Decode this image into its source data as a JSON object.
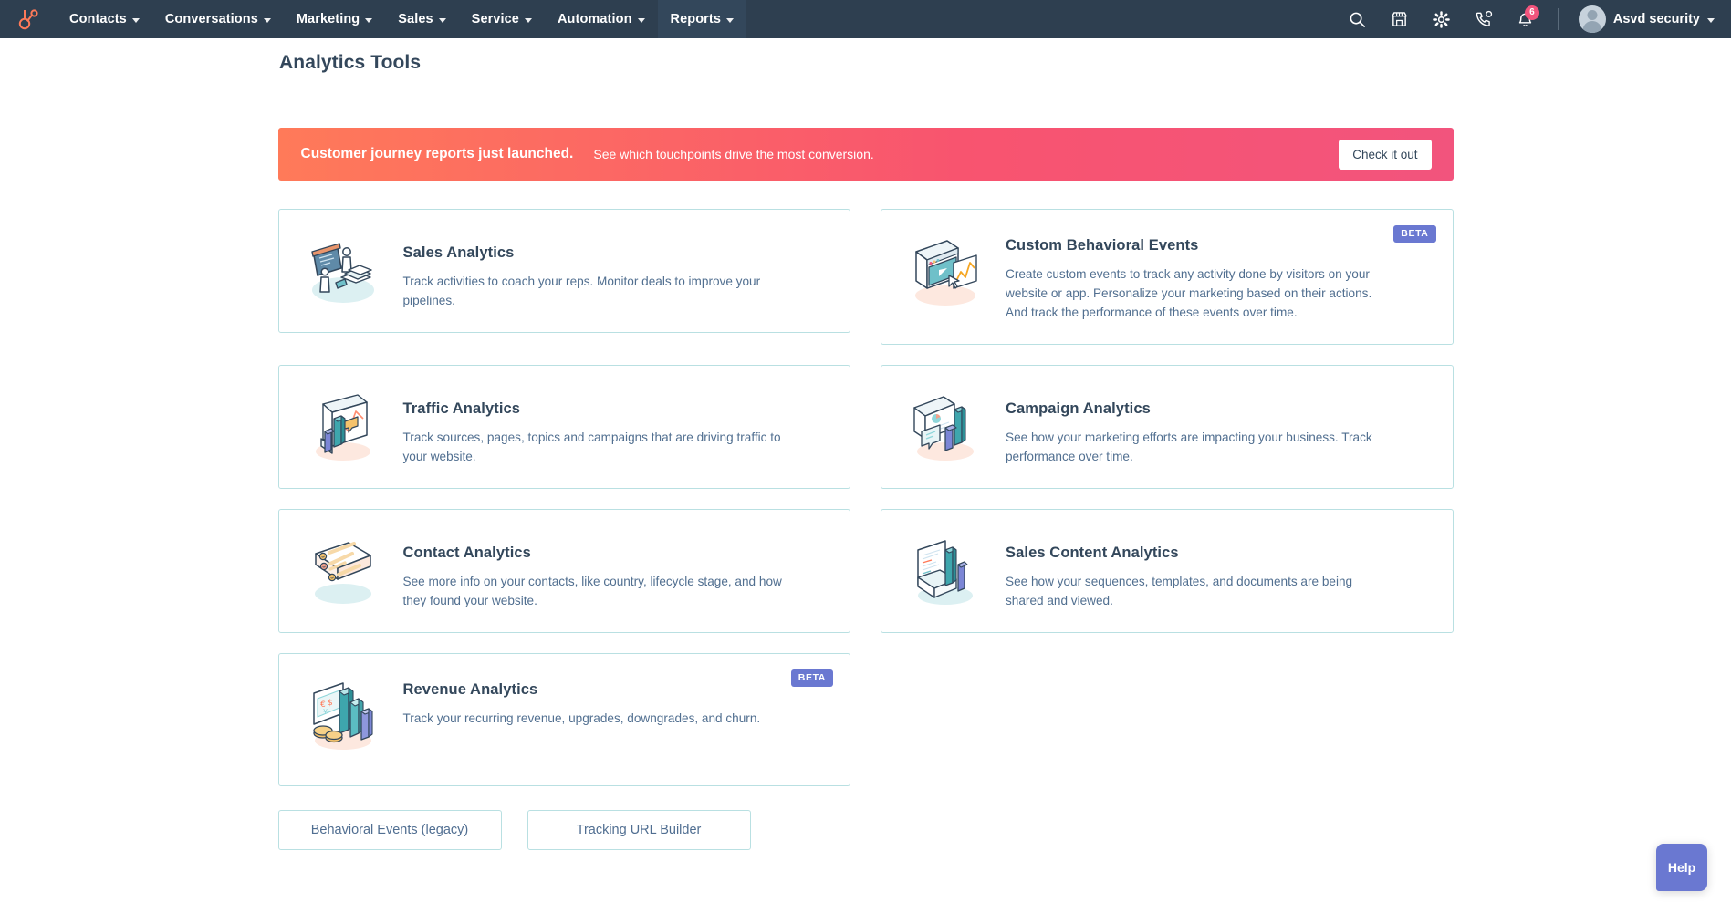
{
  "nav": {
    "logo_icon": "hubspot-sprocket-icon",
    "items": [
      {
        "label": "Contacts",
        "icon": "chevron-down-icon",
        "active": false
      },
      {
        "label": "Conversations",
        "icon": "chevron-down-icon",
        "active": false
      },
      {
        "label": "Marketing",
        "icon": "chevron-down-icon",
        "active": false
      },
      {
        "label": "Sales",
        "icon": "chevron-down-icon",
        "active": false
      },
      {
        "label": "Service",
        "icon": "chevron-down-icon",
        "active": false
      },
      {
        "label": "Automation",
        "icon": "chevron-down-icon",
        "active": false
      },
      {
        "label": "Reports",
        "icon": "chevron-down-icon",
        "active": true
      }
    ],
    "right_icons": [
      "search-icon",
      "marketplace-icon",
      "gear-icon",
      "phone-icon",
      "notifications-bell-icon"
    ],
    "notification_count": "6",
    "account_name": "Asvd security",
    "account_caret_icon": "chevron-down-icon",
    "avatar_icon": "avatar"
  },
  "header": {
    "title": "Analytics Tools"
  },
  "banner": {
    "headline": "Customer journey reports just launched.",
    "subtext": "See which touchpoints drive the most conversion.",
    "button_label": "Check it out",
    "gradient_start": "#ff7a59",
    "gradient_end": "#f2547d"
  },
  "cards": [
    {
      "title": "Sales Analytics",
      "desc": "Track activities to coach your reps. Monitor deals to improve your pipelines.",
      "badge": "",
      "illustration": "sales-analytics-illustration"
    },
    {
      "title": "Custom Behavioral Events",
      "desc": "Create custom events to track any activity done by visitors on your website or app. Personalize your marketing based on their actions. And track the performance of these events over time.",
      "badge": "BETA",
      "illustration": "custom-behavioral-events-illustration"
    },
    {
      "title": "Traffic Analytics",
      "desc": "Track sources, pages, topics and campaigns that are driving traffic to your website.",
      "badge": "",
      "illustration": "traffic-analytics-illustration"
    },
    {
      "title": "Campaign Analytics",
      "desc": "See how your marketing efforts are impacting your business. Track performance over time.",
      "badge": "",
      "illustration": "campaign-analytics-illustration"
    },
    {
      "title": "Contact Analytics",
      "desc": "See more info on your contacts, like country, lifecycle stage, and how they found your website.",
      "badge": "",
      "illustration": "contact-analytics-illustration"
    },
    {
      "title": "Sales Content Analytics",
      "desc": "See how your sequences, templates, and documents are being shared and viewed.",
      "badge": "",
      "illustration": "sales-content-analytics-illustration"
    },
    {
      "title": "Revenue Analytics",
      "desc": "Track your recurring revenue, upgrades, downgrades, and churn.",
      "badge": "BETA",
      "illustration": "revenue-analytics-illustration"
    }
  ],
  "bottom_buttons": [
    {
      "label": "Behavioral Events (legacy)"
    },
    {
      "label": "Tracking URL Builder"
    }
  ],
  "help": {
    "label": "Help",
    "color": "#6a78d1"
  },
  "colors": {
    "nav_bg": "#2e3f50",
    "card_border": "#b9e0e2",
    "text_primary": "#33475b",
    "text_secondary": "#516f90",
    "beta_badge": "#6a78d1"
  }
}
